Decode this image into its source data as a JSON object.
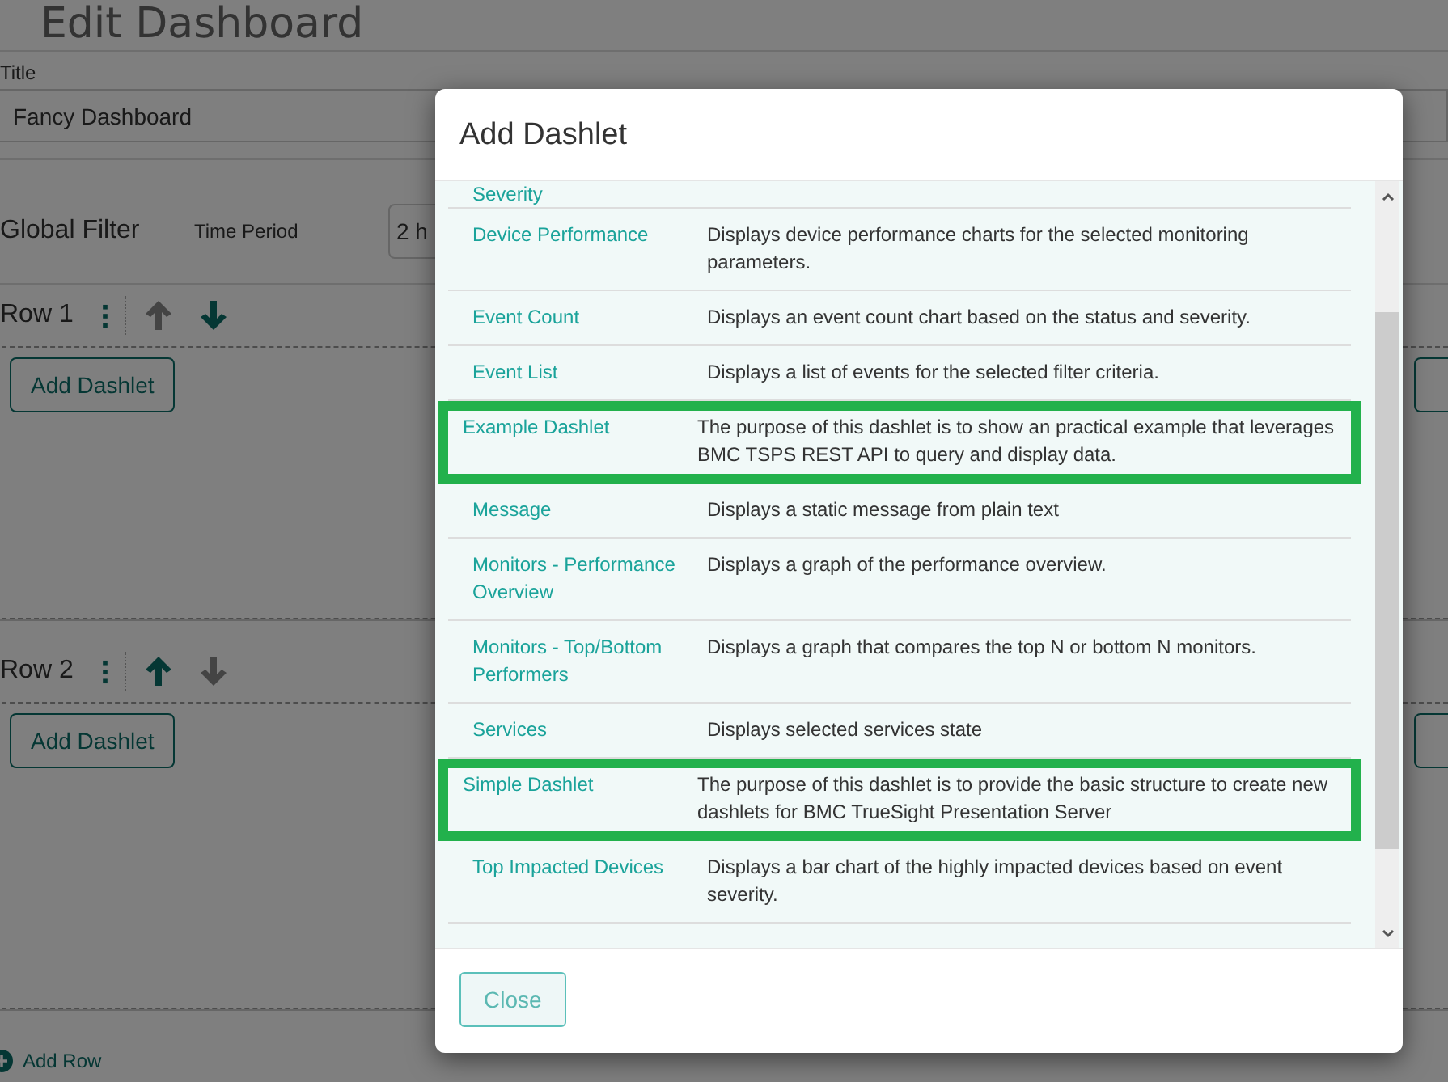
{
  "page": {
    "title": "Edit Dashboard",
    "title_label": "Title",
    "title_value": "Fancy Dashboard",
    "global_filter": "Global Filter",
    "time_period_label": "Time Period",
    "time_period_value": "2 h",
    "rows": [
      {
        "label": "Row 1",
        "up_enabled": false,
        "down_enabled": true,
        "button": "Add Dashlet"
      },
      {
        "label": "Row 2",
        "up_enabled": true,
        "down_enabled": false,
        "button": "Add Dashlet"
      }
    ],
    "add_row": "Add Row"
  },
  "dialog": {
    "title": "Add Dashlet",
    "dashlets": [
      {
        "name": "Severity",
        "highlighted": false
      },
      {
        "name": "Device Performance",
        "description": "Displays device performance charts for the selected monitoring parameters.",
        "highlighted": false
      },
      {
        "name": "Event Count",
        "description": "Displays an event count chart based on the status and severity.",
        "highlighted": false
      },
      {
        "name": "Event List",
        "description": "Displays a list of events for the selected filter criteria.",
        "highlighted": false
      },
      {
        "name": "Example Dashlet",
        "description": "The purpose of this dashlet is to show an practical example that leverages BMC TSPS REST API to query and display data.",
        "highlighted": true
      },
      {
        "name": "Message",
        "description": "Displays a static message from plain text",
        "highlighted": false
      },
      {
        "name": "Monitors - Performance Overview",
        "description": "Displays a graph of the performance overview.",
        "highlighted": false
      },
      {
        "name": "Monitors - Top/Bottom Performers",
        "description": "Displays a graph that compares the top N or bottom N monitors.",
        "highlighted": false
      },
      {
        "name": "Services",
        "description": "Displays selected services state",
        "highlighted": false
      },
      {
        "name": "Simple Dashlet",
        "description": "The purpose of this dashlet is to provide the basic structure to create new dashlets for BMC TrueSight Presentation Server",
        "highlighted": true
      },
      {
        "name": "Top Impacted Devices",
        "description": "Displays a bar chart of the highly impacted devices based on event severity.",
        "highlighted": false
      }
    ],
    "close": "Close"
  }
}
